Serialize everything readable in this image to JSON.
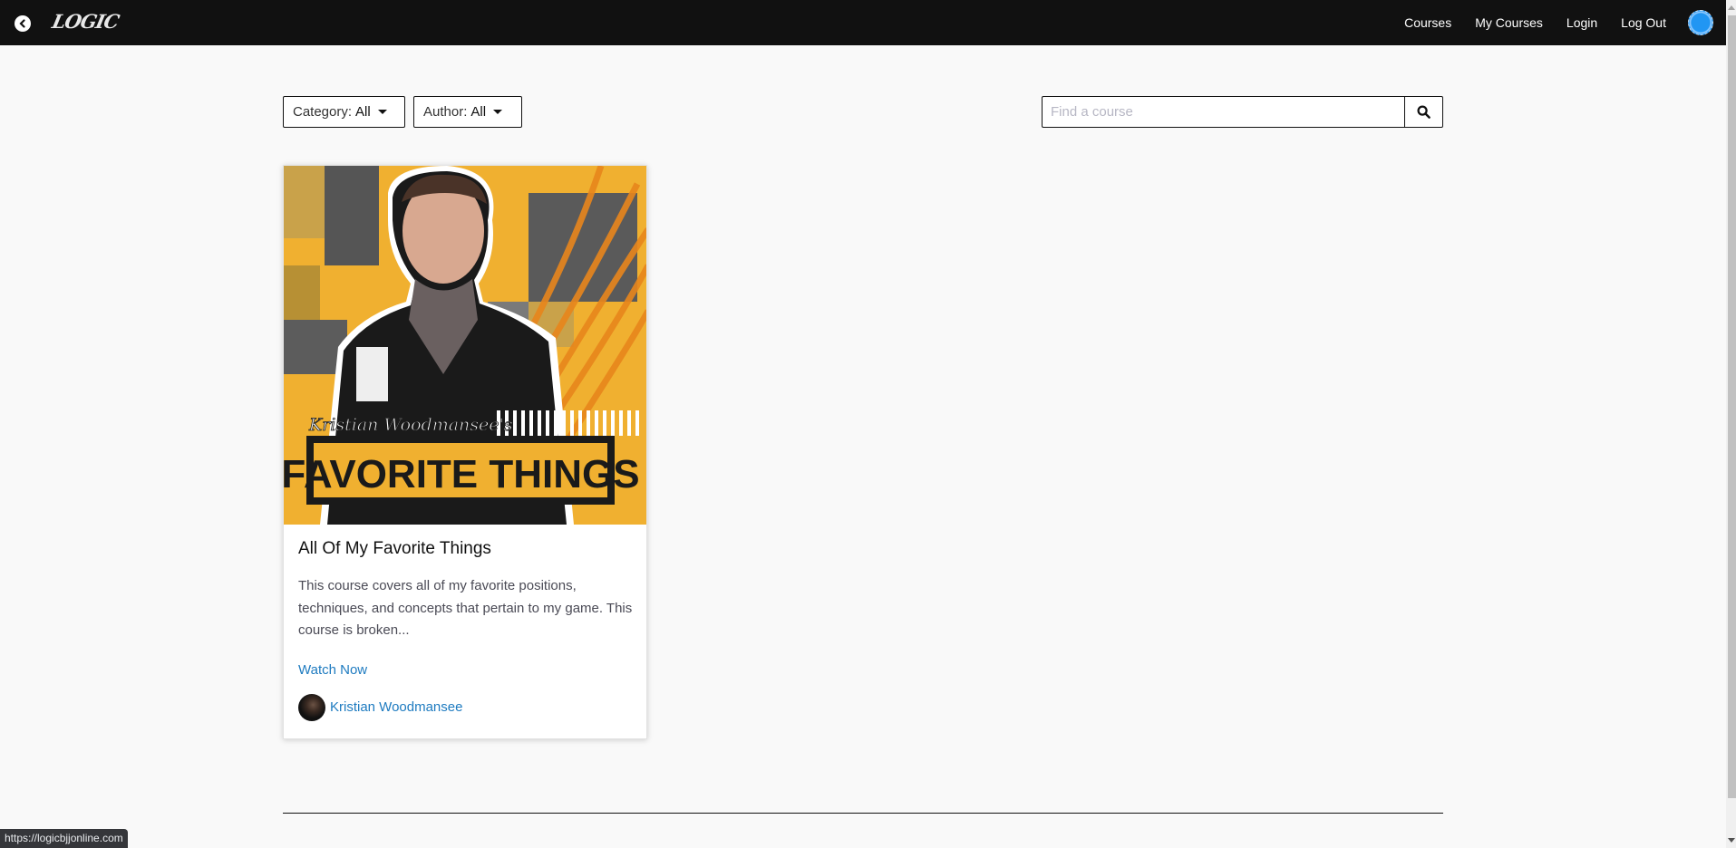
{
  "navbar": {
    "logo_text": "LOGIC",
    "links": [
      {
        "label": "Courses"
      },
      {
        "label": "My Courses"
      },
      {
        "label": "Login"
      },
      {
        "label": "Log Out"
      }
    ],
    "colors": {
      "background": "#111111",
      "avatar": "#2196f3"
    }
  },
  "filters": {
    "category": {
      "label": "Category:",
      "value": "All"
    },
    "author": {
      "label": "Author:",
      "value": "All"
    }
  },
  "search": {
    "placeholder": "Find a course",
    "value": ""
  },
  "courses": [
    {
      "title": "All Of My Favorite Things",
      "description": "This course covers all of my favorite positions, techniques, and concepts that pertain to my game. This course is broken...",
      "cta": "Watch Now",
      "author": "Kristian Woodmansee",
      "thumbnail": {
        "script_text": "Kristian Woodmansee's",
        "headline": "FAVORITE THINGS",
        "accent_color": "#f0b030"
      }
    }
  ],
  "link_color": "#1e7bc0",
  "status_bar": {
    "url": "https://logicbjjonline.com"
  }
}
